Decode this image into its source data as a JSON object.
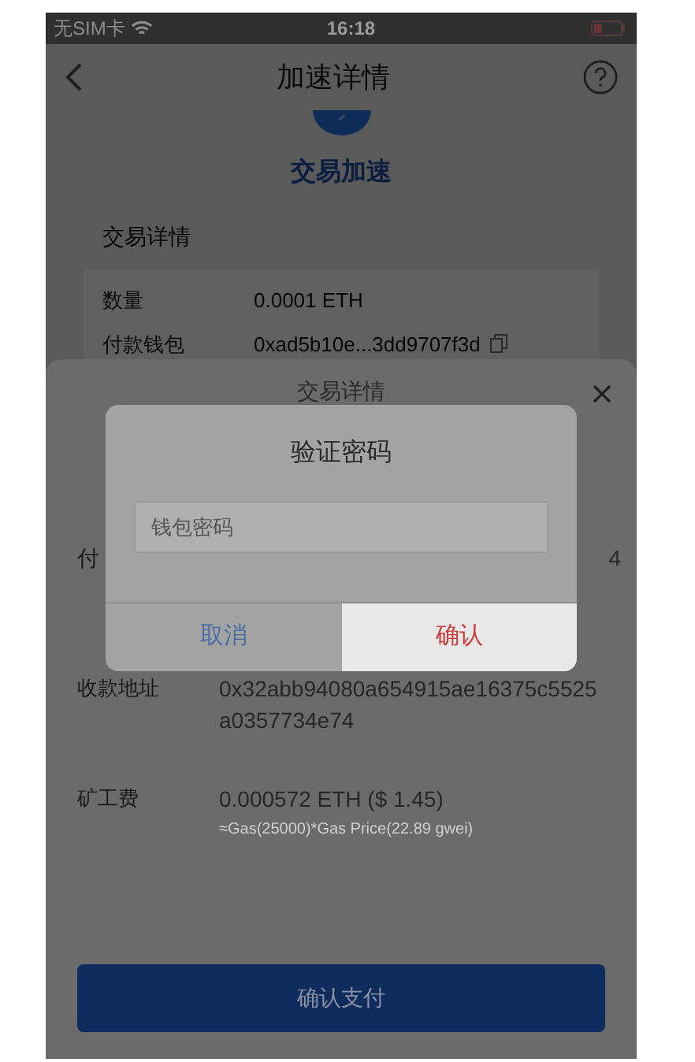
{
  "status_bar": {
    "carrier": "无SIM卡",
    "time": "16:18"
  },
  "nav": {
    "title": "加速详情"
  },
  "header": {
    "title": "交易加速"
  },
  "details": {
    "title": "交易详情",
    "rows": [
      {
        "label": "数量",
        "value": "0.0001 ETH",
        "copy": false
      },
      {
        "label": "付款钱包",
        "value": "0xad5b10e...3dd9707f3d",
        "copy": true
      }
    ]
  },
  "sheet": {
    "title": "交易详情",
    "partial_row": {
      "label": "付",
      "value": "4"
    },
    "rows": [
      {
        "label": "收款地址",
        "value": "0x32abb94080a654915ae16375c5525a0357734e74"
      },
      {
        "label": "矿工费",
        "value": "0.000572 ETH ($ 1.45)",
        "note": "≈Gas(25000)*Gas Price(22.89 gwei)"
      }
    ],
    "button": "确认支付"
  },
  "dialog": {
    "title": "验证密码",
    "field": {
      "placeholder": "钱包密码"
    },
    "buttons": [
      {
        "label": "取消",
        "kind": "cancel",
        "selected": false
      },
      {
        "label": "确认",
        "kind": "confirm",
        "selected": true
      }
    ]
  }
}
